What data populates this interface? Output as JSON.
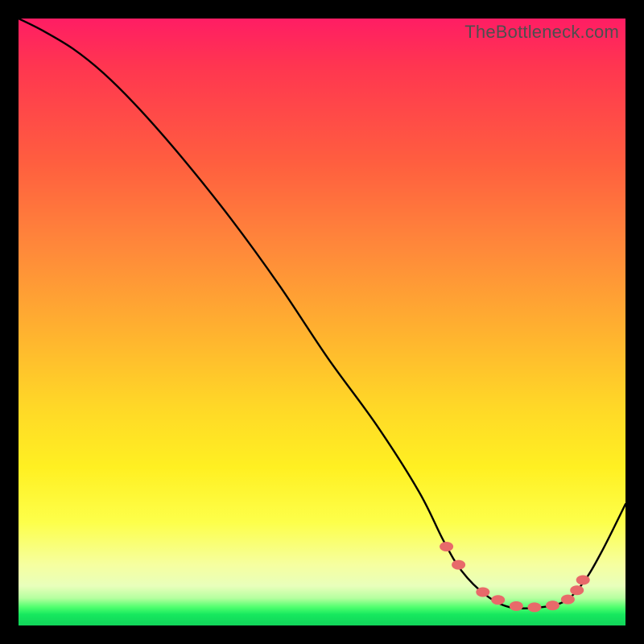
{
  "watermark": "TheBottleneck.com",
  "chart_data": {
    "type": "line",
    "title": "",
    "xlabel": "",
    "ylabel": "",
    "xlim": [
      0,
      100
    ],
    "ylim": [
      0,
      100
    ],
    "grid": false,
    "legend": false,
    "series": [
      {
        "name": "bottleneck-curve",
        "x": [
          0,
          4,
          9,
          14,
          20,
          27,
          35,
          43,
          51,
          59,
          66,
          70,
          73,
          77,
          81,
          86,
          90,
          93,
          96,
          100
        ],
        "y": [
          100,
          98,
          95,
          91,
          85,
          77,
          67,
          56,
          44,
          33,
          22,
          14,
          9,
          5,
          3,
          3,
          4,
          7,
          12,
          20
        ]
      }
    ],
    "markers": {
      "name": "highlight-points",
      "x": [
        70.5,
        72.5,
        76.5,
        79.0,
        82.0,
        85.0,
        88.0,
        90.5,
        92.0,
        93.0
      ],
      "y": [
        13.0,
        10.0,
        5.5,
        4.2,
        3.2,
        3.0,
        3.3,
        4.3,
        5.8,
        7.5
      ]
    },
    "colors": {
      "curve": "#000000",
      "marker": "#e86a6a",
      "gradient_top": "#ff1d64",
      "gradient_mid": "#ffe726",
      "gradient_bottom": "#11d45a",
      "frame": "#000000"
    }
  }
}
